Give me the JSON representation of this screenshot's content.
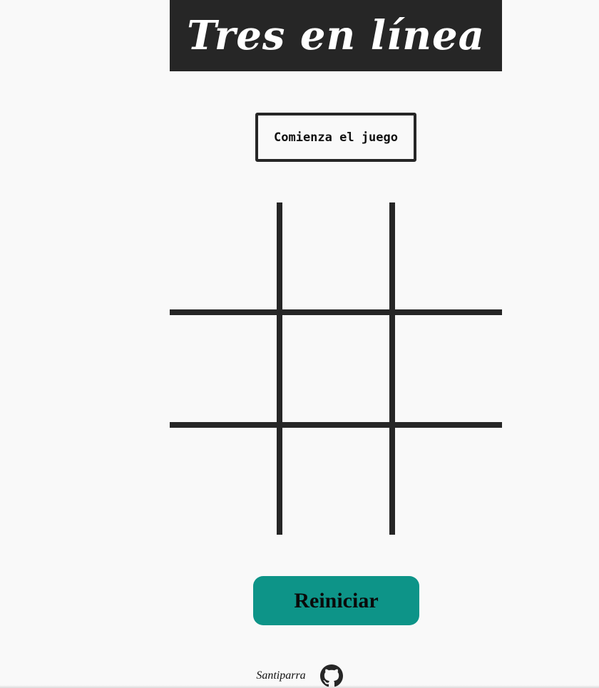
{
  "header": {
    "title": "Tres en línea"
  },
  "status": {
    "text": "Comienza el juego"
  },
  "board": {
    "cells": [
      "",
      "",
      "",
      "",
      "",
      "",
      "",
      "",
      ""
    ]
  },
  "controls": {
    "restart_label": "Reiniciar"
  },
  "footer": {
    "author": "Santiparra",
    "icon": "github-icon"
  },
  "colors": {
    "background": "#f9f9f9",
    "dark": "#262626",
    "accent": "#0d9488"
  }
}
